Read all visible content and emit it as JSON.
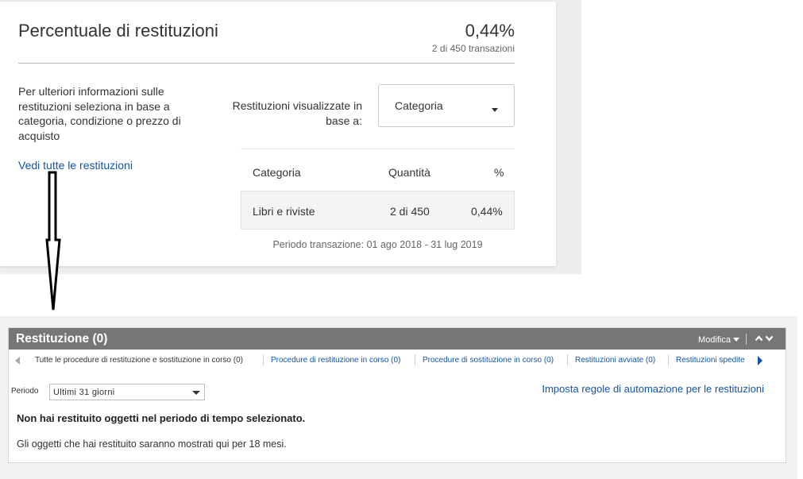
{
  "returns_rate": {
    "title": "Percentuale di restituzioni",
    "percentage": "0,44%",
    "subtext": "2 di 450 transazioni",
    "description": "Per ulteriori informazioni sulle restituzioni seleziona in base a categoria, condizione o prezzo di acquisto",
    "view_all_link": "Vedi tutte le restituzioni",
    "view_by_label": "Restituzioni visualizzate in base a:",
    "view_by_selected": "Categoria",
    "table": {
      "headers": [
        "Categoria",
        "Quantità",
        "%"
      ],
      "rows": [
        {
          "category": "Libri e riviste",
          "quantity": "2 di 450",
          "percent": "0,44%"
        }
      ]
    },
    "period": "Periodo transazione: 01 ago 2018 - 31 lug 2019"
  },
  "returns_panel": {
    "title": "Restituzione (0)",
    "edit_label": "Modifica",
    "tabs": [
      {
        "label": "Tutte le procedure di restituzione e sostituzione in corso (0)",
        "active": true
      },
      {
        "label": "Procedure di restituzione in corso (0)",
        "active": false
      },
      {
        "label": "Procedure di sostituzione in corso (0)",
        "active": false
      },
      {
        "label": "Restituzioni avviate (0)",
        "active": false
      },
      {
        "label": "Restituzioni spedite",
        "active": false
      }
    ],
    "period_label": "Periodo",
    "period_selected": "Ultimi 31 giorni",
    "automation_link": "Imposta regole di automazione per le restituzioni",
    "empty_title": "Non hai restituito oggetti nel periodo di tempo selezionato.",
    "empty_desc": "Gli oggetti che hai restituito saranno mostrati qui per 18 mesi."
  },
  "colors": {
    "link": "#1155a8",
    "header_bg": "#767676",
    "text": "#333333"
  }
}
